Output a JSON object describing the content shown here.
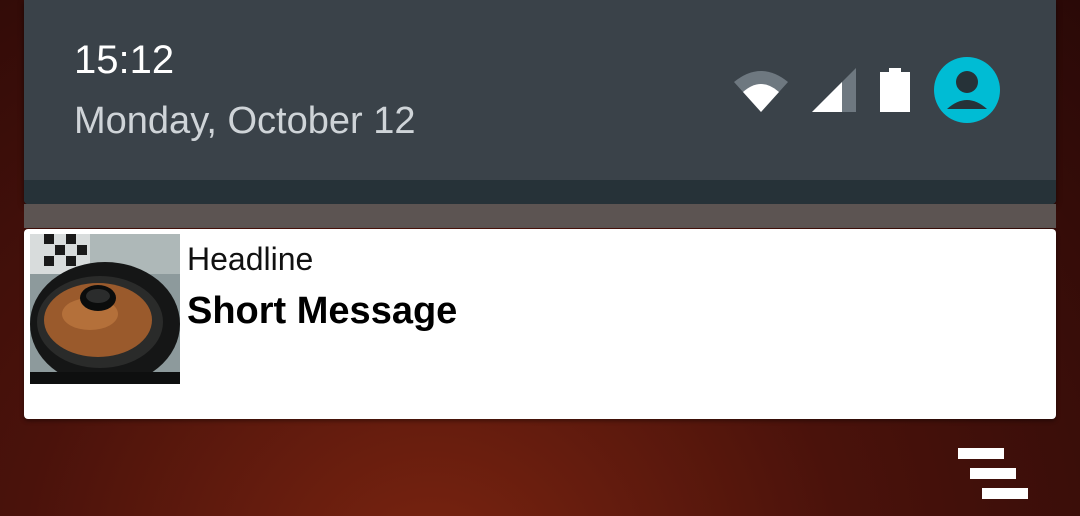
{
  "quick_settings": {
    "time": "15:12",
    "date": "Monday, October 12",
    "icons": [
      "wifi-icon",
      "cell-signal-icon",
      "battery-icon",
      "account-icon"
    ],
    "accent_color": "#00bcd4"
  },
  "notification": {
    "headline": "Headline",
    "message": "Short Message",
    "thumbnail": "cake-photo"
  },
  "clear_all": {
    "icon": "clear-all-icon"
  }
}
